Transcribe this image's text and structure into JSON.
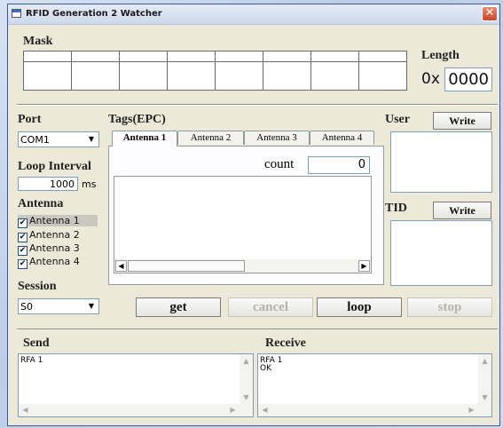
{
  "window": {
    "title": "RFID Generation 2 Watcher",
    "close_glyph": "✕"
  },
  "mask": {
    "label": "Mask",
    "length_label": "Length",
    "length_prefix": "0x",
    "length_value": "0000"
  },
  "port": {
    "label": "Port",
    "selected": "COM1"
  },
  "loop_interval": {
    "label": "Loop Interval",
    "value": "1000",
    "unit": "ms"
  },
  "antenna": {
    "label": "Antenna",
    "items": [
      {
        "label": "Antenna 1",
        "checked": true
      },
      {
        "label": "Antenna 2",
        "checked": true
      },
      {
        "label": "Antenna 3",
        "checked": true
      },
      {
        "label": "Antenna 4",
        "checked": true
      }
    ]
  },
  "session": {
    "label": "Session",
    "selected": "S0"
  },
  "tags": {
    "label": "Tags(EPC)",
    "tabs": [
      "Antenna 1",
      "Antenna 2",
      "Antenna 3",
      "Antenna 4"
    ],
    "count_label": "count",
    "count_value": "0"
  },
  "user": {
    "label": "User",
    "write_label": "Write"
  },
  "tid": {
    "label": "TID",
    "write_label": "Write"
  },
  "actions": {
    "get": "get",
    "cancel": "cancel",
    "loop": "loop",
    "stop": "stop"
  },
  "send": {
    "label": "Send",
    "text": "RFA 1"
  },
  "receive": {
    "label": "Receive",
    "text": "RFA 1\nOK"
  },
  "icons": {
    "checkbox": "check-icon",
    "dropdown": "chevron-down-icon"
  }
}
